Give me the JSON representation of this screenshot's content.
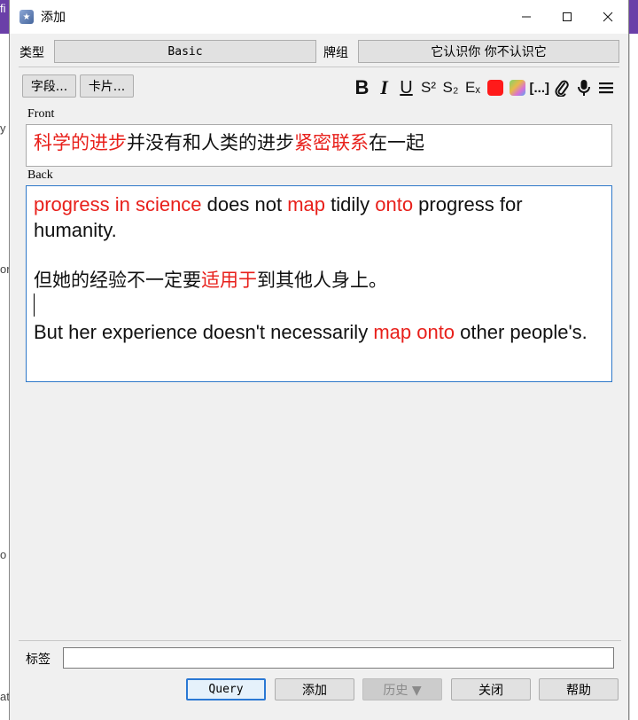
{
  "window": {
    "title": "添加"
  },
  "toolbar_row": {
    "type_label": "类型",
    "type_value": "Basic",
    "deck_label": "牌组",
    "deck_value": "它认识你 你不认识它"
  },
  "actions": {
    "fields_button": "字段...",
    "cards_button": "卡片..."
  },
  "format": {
    "bold": "B",
    "italic": "I",
    "underline": "U",
    "superscript": "S²",
    "subscript": "S₂",
    "clear_format": "Eₓ",
    "text_color": "#ff1a1a",
    "cloze": "[...]"
  },
  "fields": {
    "front_label": "Front",
    "front_parts": [
      {
        "text": "科学的进步",
        "red": true
      },
      {
        "text": "并没有和人类的进步",
        "red": false
      },
      {
        "text": "紧密联系",
        "red": true
      },
      {
        "text": "在一起",
        "red": false
      }
    ],
    "back_label": "Back",
    "back_line1": [
      {
        "text": "progress in science",
        "red": true
      },
      {
        "text": " does not ",
        "red": false
      },
      {
        "text": "map",
        "red": true
      },
      {
        "text": " tidily ",
        "red": false
      },
      {
        "text": "onto",
        "red": true
      },
      {
        "text": " progress for humanity.",
        "red": false
      }
    ],
    "back_line2": [
      {
        "text": "但她的经验不一定要",
        "red": false
      },
      {
        "text": "适用于",
        "red": true
      },
      {
        "text": "到其他人身上。",
        "red": false
      }
    ],
    "back_line3": [
      {
        "text": "But her experience doesn't necessarily ",
        "red": false
      },
      {
        "text": "map onto",
        "red": true
      },
      {
        "text": " other people's.",
        "red": false
      }
    ]
  },
  "bottom": {
    "tags_label": "标签",
    "query_button": "Query",
    "add_button": "添加",
    "history_button": "历史 ▼",
    "close_button": "关闭",
    "help_button": "帮助"
  },
  "background": {
    "frag1": "y",
    "frag2": "or",
    "frag3": "o",
    "frag4": "at",
    "frag_top": "fi"
  }
}
